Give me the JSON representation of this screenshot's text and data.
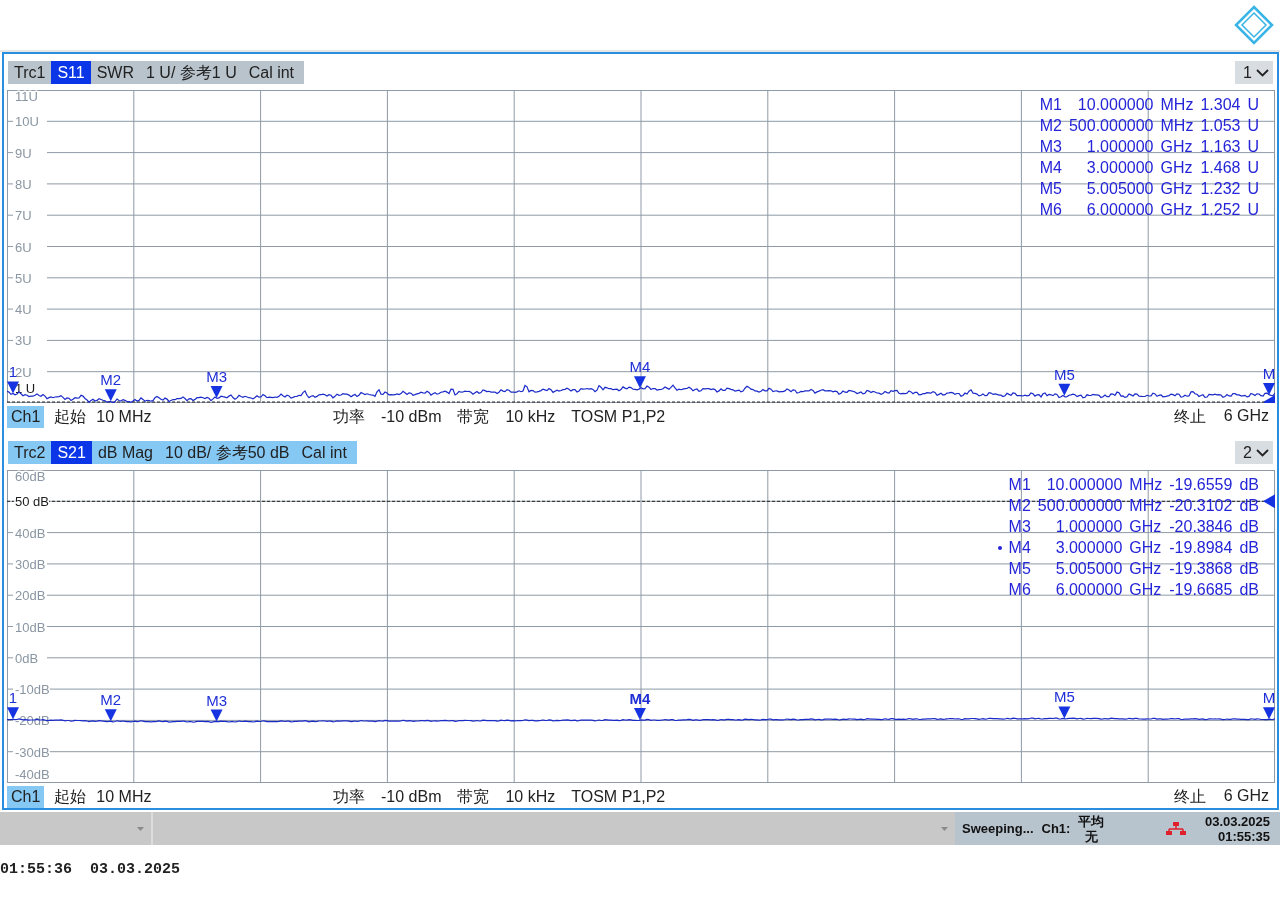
{
  "diagrams": [
    {
      "number": "1",
      "trace": {
        "active": false,
        "items": [
          {
            "text": "Trc1",
            "kind": "name"
          },
          {
            "text": "S11",
            "kind": "param"
          },
          {
            "text": "SWR",
            "kind": "text"
          },
          {
            "text": "1 U/ 参考1 U",
            "kind": "text"
          },
          {
            "text": "Cal int",
            "kind": "text"
          }
        ]
      },
      "y_labels": [
        {
          "text": "11U",
          "kind": "tick"
        },
        {
          "text": "10U",
          "kind": "tick"
        },
        {
          "text": "9U",
          "kind": "tick"
        },
        {
          "text": "8U",
          "kind": "tick"
        },
        {
          "text": "7U",
          "kind": "tick"
        },
        {
          "text": "6U",
          "kind": "tick"
        },
        {
          "text": "5U",
          "kind": "tick"
        },
        {
          "text": "4U",
          "kind": "tick"
        },
        {
          "text": "3U",
          "kind": "tick"
        },
        {
          "text": "2U",
          "kind": "tick"
        },
        {
          "text": "1 U",
          "kind": "reference"
        }
      ],
      "markers": [
        {
          "name": "M1",
          "plot_label": "1",
          "stimulus": "10.000000",
          "stimulus_unit": "MHz",
          "value": "1.304",
          "value_unit": "U",
          "active": false
        },
        {
          "name": "M2",
          "plot_label": "M2",
          "stimulus": "500.000000",
          "stimulus_unit": "MHz",
          "value": "1.053",
          "value_unit": "U",
          "active": false
        },
        {
          "name": "M3",
          "plot_label": "M3",
          "stimulus": "1.000000",
          "stimulus_unit": "GHz",
          "value": "1.163",
          "value_unit": "U",
          "active": false
        },
        {
          "name": "M4",
          "plot_label": "M4",
          "stimulus": "3.000000",
          "stimulus_unit": "GHz",
          "value": "1.468",
          "value_unit": "U",
          "active": false
        },
        {
          "name": "M5",
          "plot_label": "M5",
          "stimulus": "5.005000",
          "stimulus_unit": "GHz",
          "value": "1.232",
          "value_unit": "U",
          "active": false
        },
        {
          "name": "M6",
          "plot_label": "M",
          "stimulus": "6.000000",
          "stimulus_unit": "GHz",
          "value": "1.252",
          "value_unit": "U",
          "active": false
        }
      ],
      "channel_bar": {
        "channel": "Ch1",
        "start_label": "起始",
        "start": "10 MHz",
        "power_label": "功率",
        "power": "-10 dBm",
        "bandwidth_label": "带宽",
        "bandwidth": "10 kHz",
        "calibration": "TOSM P1,P2",
        "stop_label": "终止",
        "stop": "6 GHz"
      }
    },
    {
      "number": "2",
      "trace": {
        "active": true,
        "items": [
          {
            "text": "Trc2",
            "kind": "name"
          },
          {
            "text": "S21",
            "kind": "param"
          },
          {
            "text": "dB Mag",
            "kind": "text"
          },
          {
            "text": "10 dB/ 参考50 dB",
            "kind": "text"
          },
          {
            "text": "Cal int",
            "kind": "text"
          }
        ]
      },
      "y_labels": [
        {
          "text": "60dB",
          "kind": "tick"
        },
        {
          "text": "50 dB",
          "kind": "reference"
        },
        {
          "text": "40dB",
          "kind": "tick"
        },
        {
          "text": "30dB",
          "kind": "tick"
        },
        {
          "text": "20dB",
          "kind": "tick"
        },
        {
          "text": "10dB",
          "kind": "tick"
        },
        {
          "text": "0dB",
          "kind": "tick"
        },
        {
          "text": "-10dB",
          "kind": "tick"
        },
        {
          "text": "-20dB",
          "kind": "tick"
        },
        {
          "text": "-30dB",
          "kind": "tick"
        },
        {
          "text": "-40dB",
          "kind": "tick"
        }
      ],
      "markers": [
        {
          "name": "M1",
          "plot_label": "1",
          "stimulus": "10.000000",
          "stimulus_unit": "MHz",
          "value": "-19.6559",
          "value_unit": "dB",
          "active": false
        },
        {
          "name": "M2",
          "plot_label": "M2",
          "stimulus": "500.000000",
          "stimulus_unit": "MHz",
          "value": "-20.3102",
          "value_unit": "dB",
          "active": false
        },
        {
          "name": "M3",
          "plot_label": "M3",
          "stimulus": "1.000000",
          "stimulus_unit": "GHz",
          "value": "-20.3846",
          "value_unit": "dB",
          "active": false
        },
        {
          "name": "M4",
          "plot_label": "M4",
          "stimulus": "3.000000",
          "stimulus_unit": "GHz",
          "value": "-19.8984",
          "value_unit": "dB",
          "active": true
        },
        {
          "name": "M5",
          "plot_label": "M5",
          "stimulus": "5.005000",
          "stimulus_unit": "GHz",
          "value": "-19.3868",
          "value_unit": "dB",
          "active": false
        },
        {
          "name": "M6",
          "plot_label": "M",
          "stimulus": "6.000000",
          "stimulus_unit": "GHz",
          "value": "-19.6685",
          "value_unit": "dB",
          "active": false
        }
      ],
      "channel_bar": {
        "channel": "Ch1",
        "start_label": "起始",
        "start": "10 MHz",
        "power_label": "功率",
        "power": "-10 dBm",
        "bandwidth_label": "带宽",
        "bandwidth": "10 kHz",
        "calibration": "TOSM P1,P2",
        "stop_label": "终止",
        "stop": "6 GHz"
      }
    }
  ],
  "status_bar": {
    "state": "Sweeping...",
    "channel": "Ch1:",
    "average_label": "平均",
    "average_value": "无",
    "date": "03.03.2025",
    "time": "01:55:35"
  },
  "clock": "01:55:36  03.03.2025"
}
